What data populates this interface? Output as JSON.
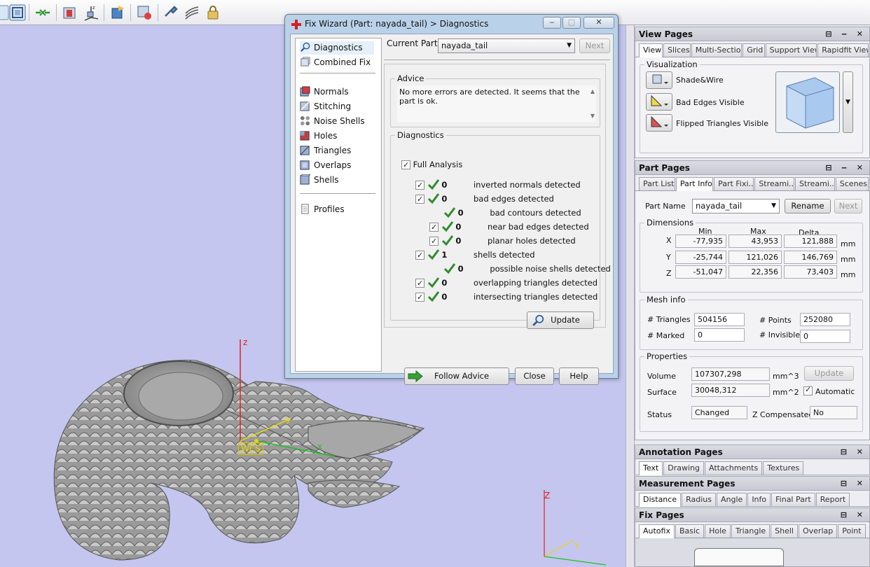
{
  "toolbar": {
    "buttons": [
      "select-icon",
      "view-icon",
      "move-parts-icon",
      "part-box-icon",
      "axis-rotate-icon",
      "add-part-icon",
      "fix-part-icon",
      "tools-icon",
      "slices-icon",
      "lock-icon"
    ]
  },
  "viewport": {
    "wcs_label": "WCS",
    "axis_z": "z",
    "axis_y": "y",
    "axis_x": "x",
    "corner_z": "Z",
    "corner_y": "Y"
  },
  "dialog": {
    "title": "Fix Wizard (Part: nayada_tail) > Diagnostics",
    "current_part_label": "Current Part:",
    "current_part_value": "nayada_tail",
    "next": "Next",
    "advice_title": "Advice",
    "advice_text": "No more errors are detected. It seems that the part is ok.",
    "diagnostics_title": "Diagnostics",
    "full_analysis": "Full Analysis",
    "update": "Update",
    "follow_advice": "Follow Advice",
    "close": "Close",
    "help": "Help",
    "nav": {
      "diagnostics": "Diagnostics",
      "combined_fix": "Combined Fix",
      "normals": "Normals",
      "stitching": "Stitching",
      "noise_shells": "Noise Shells",
      "holes": "Holes",
      "triangles": "Triangles",
      "overlaps": "Overlaps",
      "shells": "Shells",
      "profiles": "Profiles"
    },
    "rows": [
      {
        "count": "0",
        "text": "inverted normals detected",
        "checkbox": true
      },
      {
        "count": "0",
        "text": "bad edges detected",
        "checkbox": true
      },
      {
        "count": "0",
        "text": "bad contours detected",
        "checkbox": false
      },
      {
        "count": "0",
        "text": "near bad edges detected",
        "checkbox": true
      },
      {
        "count": "0",
        "text": "planar holes detected",
        "checkbox": true
      },
      {
        "count": "1",
        "text": "shells detected",
        "checkbox": true
      },
      {
        "count": "0",
        "text": "possible noise shells detected",
        "checkbox": false
      },
      {
        "count": "0",
        "text": "overlapping triangles detected",
        "checkbox": true
      },
      {
        "count": "0",
        "text": "intersecting triangles detected",
        "checkbox": true
      }
    ]
  },
  "view_pages": {
    "title": "View Pages",
    "tabs": [
      "View",
      "Slices",
      "Multi-Section",
      "Grid",
      "Support View",
      "Rapidfit View"
    ],
    "visualization": "Visualization",
    "options": [
      "Shade&Wire",
      "Bad Edges Visible",
      "Flipped Triangles Visible"
    ]
  },
  "part_pages": {
    "title": "Part Pages",
    "tabs": [
      "Part List",
      "Part Info",
      "Part Fixi..",
      "Streami..",
      "Streami..",
      "Scenes"
    ],
    "part_name_label": "Part Name",
    "part_name_value": "nayada_tail",
    "rename": "Rename",
    "next": "Next",
    "dimensions": "Dimensions",
    "col_min": "Min",
    "col_max": "Max",
    "col_delta": "Delta",
    "dims": [
      {
        "axis": "X",
        "min": "-77,935",
        "max": "43,953",
        "delta": "121,888",
        "unit": "mm"
      },
      {
        "axis": "Y",
        "min": "-25,744",
        "max": "121,026",
        "delta": "146,769",
        "unit": "mm"
      },
      {
        "axis": "Z",
        "min": "-51,047",
        "max": "22,356",
        "delta": "73,403",
        "unit": "mm"
      }
    ],
    "mesh_info": "Mesh info",
    "triangles_label": "# Triangles",
    "triangles_value": "504156",
    "points_label": "# Points",
    "points_value": "252080",
    "marked_label": "# Marked",
    "marked_value": "0",
    "invisible_label": "# Invisible",
    "invisible_value": "0",
    "properties": "Properties",
    "volume_label": "Volume",
    "volume_value": "107307,298",
    "volume_unit": "mm^3",
    "surface_label": "Surface",
    "surface_value": "30048,312",
    "surface_unit": "mm^2",
    "update": "Update",
    "automatic": "Automatic",
    "status_label": "Status",
    "status_value": "Changed",
    "zcomp_label": "Z Compensated",
    "zcomp_value": "No"
  },
  "annotation_pages": {
    "title": "Annotation Pages",
    "tabs": [
      "Text",
      "Drawing",
      "Attachments",
      "Textures"
    ]
  },
  "measurement_pages": {
    "title": "Measurement Pages",
    "tabs": [
      "Distance",
      "Radius",
      "Angle",
      "Info",
      "Final Part",
      "Report"
    ]
  },
  "fix_pages": {
    "title": "Fix Pages",
    "tabs": [
      "Autofix",
      "Basic",
      "Hole",
      "Triangle",
      "Shell",
      "Overlap",
      "Point"
    ]
  },
  "colors": {
    "viewport_bg": "#c4c6ef",
    "tick_green": "#2e8b2e",
    "axis_red": "#e02020",
    "axis_green": "#20c020",
    "axis_yellow": "#e8d800"
  }
}
